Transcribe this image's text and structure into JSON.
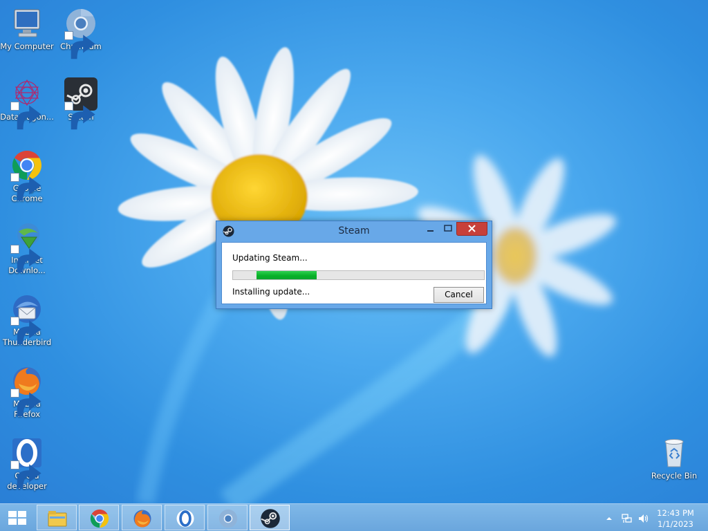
{
  "desktop": {
    "icons": [
      {
        "label": "My Computer",
        "icon": "computer-icon"
      },
      {
        "label": "Chromium",
        "icon": "chromium-icon"
      },
      {
        "label": "DataWagon...",
        "icon": "datawagon-icon"
      },
      {
        "label": "Steam",
        "icon": "steam-icon"
      },
      {
        "label": "Google Chrome",
        "icon": "chrome-icon"
      },
      {
        "label": "Internet Downlo...",
        "icon": "internet-download-manager-icon"
      },
      {
        "label": "Mozilla Thunderbird",
        "icon": "thunderbird-icon"
      },
      {
        "label": "Mozilla Firefox",
        "icon": "firefox-icon"
      },
      {
        "label": "Opera developer",
        "icon": "opera-developer-icon"
      },
      {
        "label": "Recycle Bin",
        "icon": "recycle-bin-icon"
      }
    ]
  },
  "dialog": {
    "title": "Steam",
    "status_top": "Updating Steam...",
    "status_bottom": "Installing update...",
    "cancel_label": "Cancel",
    "progress_fraction": 0.35,
    "progress_color": "#06b025"
  },
  "taskbar": {
    "pinned": [
      "file-explorer-icon",
      "chrome-icon",
      "firefox-icon",
      "opera-icon",
      "chromium-icon",
      "steam-icon"
    ],
    "active": "steam-icon",
    "clock_time": "12:43 PM",
    "clock_date": "1/1/2023"
  },
  "colors": {
    "desktop_blue": "#3d9ee6",
    "dialog_frame": "#68a8e8",
    "close_button": "#c7403a"
  }
}
